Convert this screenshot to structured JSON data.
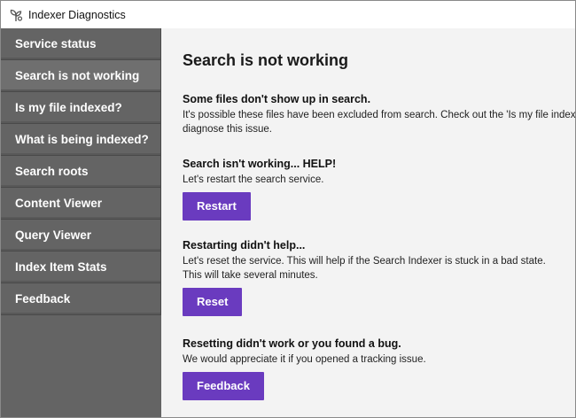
{
  "window": {
    "title": "Indexer Diagnostics",
    "app_icon": "flower-sprout-icon"
  },
  "sidebar": {
    "items": [
      {
        "label": "Service status"
      },
      {
        "label": "Search is not working"
      },
      {
        "label": "Is my file indexed?"
      },
      {
        "label": "What is being indexed?"
      },
      {
        "label": "Search roots"
      },
      {
        "label": "Content Viewer"
      },
      {
        "label": "Query Viewer"
      },
      {
        "label": "Index Item Stats"
      },
      {
        "label": "Feedback"
      }
    ],
    "active_index": 1
  },
  "main": {
    "title": "Search is not working",
    "sections": [
      {
        "heading": "Some files don't show up in search.",
        "lines": [
          "It's possible these files have been excluded from search. Check out the 'Is my file indexed?' page to",
          "diagnose this issue."
        ]
      },
      {
        "heading": "Search isn't working... HELP!",
        "lines": [
          "Let's restart the search service."
        ],
        "button": "Restart"
      },
      {
        "heading": "Restarting didn't help...",
        "lines": [
          "Let's reset the service. This will help if the Search Indexer is stuck in a bad state.",
          "This will take several minutes."
        ],
        "button": "Reset"
      },
      {
        "heading": "Resetting didn't work or you found a bug.",
        "lines": [
          "We would appreciate it if you opened a tracking issue."
        ],
        "button": "Feedback"
      }
    ]
  },
  "colors": {
    "accent": "#6a3bbf",
    "sidebar": "#646464",
    "background": "#f3f3f3"
  }
}
